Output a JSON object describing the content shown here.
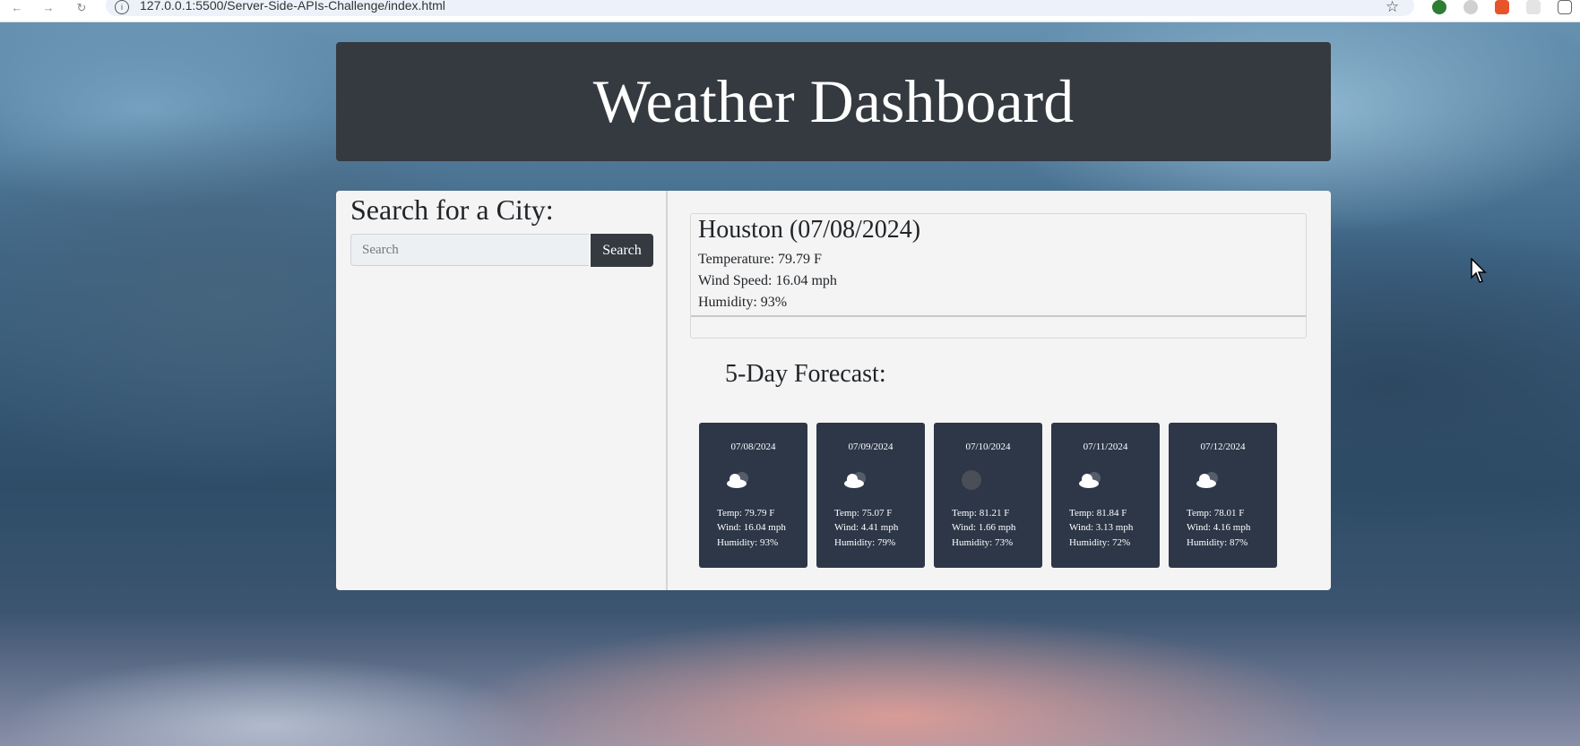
{
  "browser": {
    "url": "127.0.0.1:5500/Server-Side-APIs-Challenge/index.html",
    "icons": [
      "back-arrow-icon",
      "forward-arrow-icon",
      "reload-icon",
      "site-info-icon",
      "bookmark-star-icon"
    ]
  },
  "header": {
    "title": "Weather Dashboard"
  },
  "search": {
    "title": "Search for a City:",
    "placeholder": "Search",
    "button_label": "Search"
  },
  "current": {
    "heading": "Houston (07/08/2024)",
    "temperature": "Temperature: 79.79 F",
    "wind": "Wind Speed: 16.04 mph",
    "humidity": "Humidity: 93%"
  },
  "forecast": {
    "title": "5-Day Forecast:",
    "days": [
      {
        "date": "07/08/2024",
        "icon": "cloud-icon",
        "temp": "Temp: 79.79 F",
        "wind": "Wind: 16.04 mph",
        "humidity": "Humidity: 93%"
      },
      {
        "date": "07/09/2024",
        "icon": "cloud-icon",
        "temp": "Temp: 75.07 F",
        "wind": "Wind: 4.41 mph",
        "humidity": "Humidity: 79%"
      },
      {
        "date": "07/10/2024",
        "icon": "dark-circle-icon",
        "temp": "Temp: 81.21 F",
        "wind": "Wind: 1.66 mph",
        "humidity": "Humidity: 73%"
      },
      {
        "date": "07/11/2024",
        "icon": "cloud-icon",
        "temp": "Temp: 81.84 F",
        "wind": "Wind: 3.13 mph",
        "humidity": "Humidity: 72%"
      },
      {
        "date": "07/12/2024",
        "icon": "cloud-icon",
        "temp": "Temp: 78.01 F",
        "wind": "Wind: 4.16 mph",
        "humidity": "Humidity: 87%"
      }
    ]
  },
  "colors": {
    "header_bg": "#343a40",
    "panel_bg": "#f4f4f4",
    "card_bg": "#2d3748"
  }
}
